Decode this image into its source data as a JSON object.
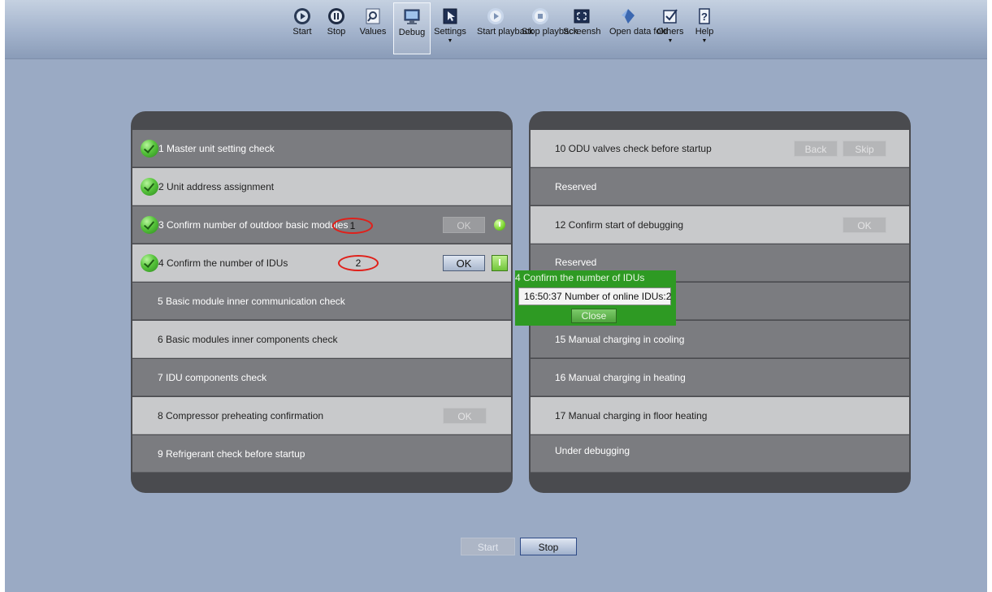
{
  "toolbar": {
    "buttons": [
      {
        "label": "Start",
        "icon": "play-circle-icon"
      },
      {
        "label": "Stop",
        "icon": "pause-circle-icon"
      },
      {
        "label": "Values",
        "icon": "magnifier-icon"
      },
      {
        "label": "Debug",
        "icon": "monitor-icon",
        "active": true
      },
      {
        "label": "Settings",
        "icon": "cursor-icon",
        "dropdown": true
      },
      {
        "label": "Start playback",
        "icon": "playback-start-icon"
      },
      {
        "label": "Stop playback",
        "icon": "playback-stop-icon"
      },
      {
        "label": "Screensh",
        "icon": "screenshot-icon"
      },
      {
        "label": "Open data fold",
        "icon": "folder-open-icon"
      },
      {
        "label": "Others",
        "icon": "checkbox-icon",
        "dropdown": true
      },
      {
        "label": "Help",
        "icon": "help-icon",
        "dropdown": true
      }
    ]
  },
  "left_panel": {
    "rows": [
      {
        "label": "1 Master unit setting check",
        "checked": true
      },
      {
        "label": "2 Unit address assignment",
        "checked": true
      },
      {
        "label": "3 Confirm number of outdoor basic modules",
        "checked": true,
        "ok_label": "OK",
        "annotation": "1"
      },
      {
        "label": "4 Confirm the number of IDUs",
        "checked": true,
        "ok_label": "OK",
        "annotation": "2"
      },
      {
        "label": "5 Basic module inner communication check"
      },
      {
        "label": "6 Basic modules inner components check"
      },
      {
        "label": "7 IDU components check"
      },
      {
        "label": "8 Compressor preheating confirmation",
        "ok_label": "OK"
      },
      {
        "label": "9 Refrigerant check before startup"
      }
    ]
  },
  "right_panel": {
    "rows": [
      {
        "label": "10 ODU valves check before startup",
        "back_label": "Back",
        "skip_label": "Skip"
      },
      {
        "label": "Reserved"
      },
      {
        "label": "12 Confirm start of debugging",
        "ok_label": "OK"
      },
      {
        "label": "Reserved"
      },
      {
        "label": ""
      },
      {
        "label": "15 Manual charging in cooling"
      },
      {
        "label": "16 Manual charging in heating"
      },
      {
        "label": "17 Manual charging in floor heating"
      },
      {
        "label": "Under debugging"
      }
    ]
  },
  "popup": {
    "title": "4 Confirm the number of IDUs",
    "message": "16:50:37 Number of online IDUs:2",
    "close_label": "Close"
  },
  "bottom": {
    "start_label": "Start",
    "stop_label": "Stop"
  },
  "colors": {
    "background": "#9aaac4",
    "row_dark": "#7b7c80",
    "row_light": "#c8c9cb",
    "popup_green": "#2e9a23",
    "annotation_red": "#e0201a"
  }
}
